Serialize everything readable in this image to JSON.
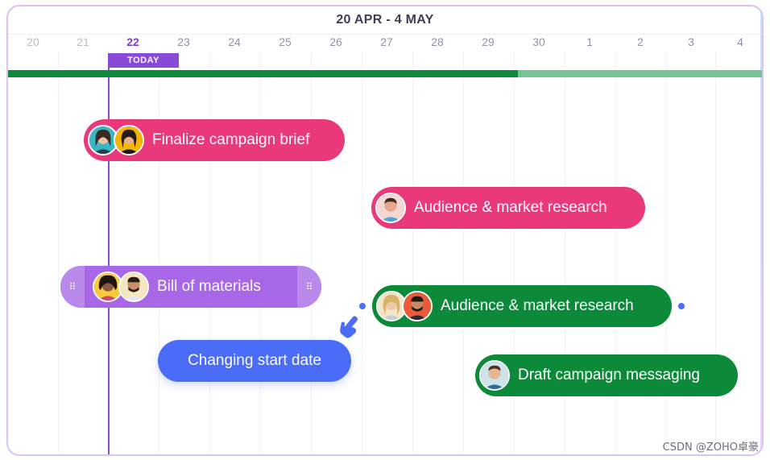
{
  "header": {
    "date_range": "20 APR - 4 MAY"
  },
  "days": [
    "20",
    "21",
    "22",
    "23",
    "24",
    "25",
    "26",
    "27",
    "28",
    "29",
    "30",
    "1",
    "2",
    "3",
    "4"
  ],
  "today": {
    "label": "TODAY",
    "day": "22"
  },
  "progress": {
    "completed_fraction": 0.67
  },
  "tasks": [
    {
      "label": "Finalize campaign brief",
      "color": "#e9397a",
      "avatars": [
        "person-woman-icon",
        "person-woman-icon"
      ]
    },
    {
      "label": "Audience & market research",
      "color": "#e9397a",
      "avatars": [
        "person-man-icon"
      ]
    },
    {
      "label": "Bill of materials",
      "color": "#a767e6",
      "avatars": [
        "person-woman-icon",
        "person-man-icon"
      ]
    },
    {
      "label": "Audience & market research",
      "color": "#0c8a3a",
      "avatars": [
        "person-woman-icon",
        "person-man-icon"
      ]
    },
    {
      "label": "Draft campaign messaging",
      "color": "#0c8a3a",
      "avatars": [
        "person-man-icon"
      ]
    }
  ],
  "drag_hint": {
    "label": "Changing start date",
    "color": "#4a6cf7",
    "icon": "hand-pointer-icon"
  },
  "icons": {
    "drag_handle": "⠿"
  },
  "watermark": "CSDN @ZOHO卓豪"
}
